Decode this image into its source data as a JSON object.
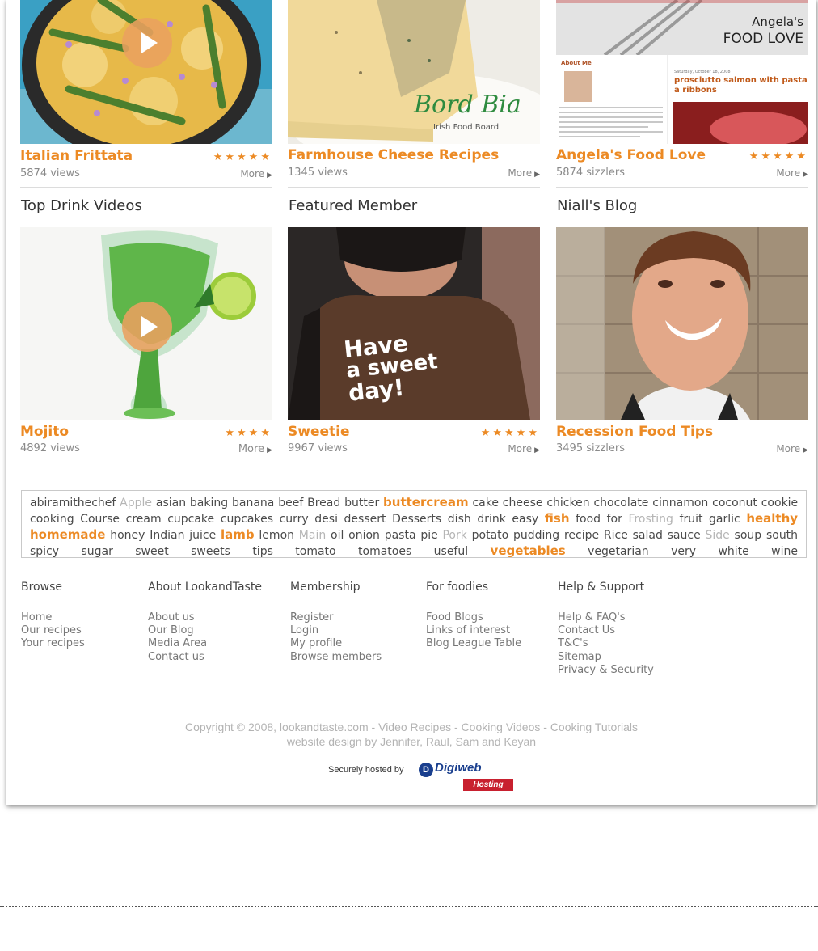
{
  "top_cards": [
    {
      "title": "Italian Frittata",
      "sub": "5874 views",
      "more": "More",
      "stars": "★★★★★"
    },
    {
      "title": "Farmhouse Cheese Recipes",
      "sub": "1345 views",
      "more": "More",
      "stars": ""
    },
    {
      "title": "Angela's Food Love",
      "sub": "5874 sizzlers",
      "more": "More",
      "stars": "★★★★★"
    }
  ],
  "top_images": {
    "cheese_brand": "Bord Bia",
    "cheese_brand_sub": "Irish Food Board",
    "angela_blog_title_1": "Angela's",
    "angela_blog_title_2": "FOOD LOVE",
    "angela_about": "About Me",
    "angela_post_date": "Saturday, October 18, 2008",
    "angela_post_title": "prosciutto salmon with pasta a ribbons"
  },
  "sections": {
    "drinks": "Top Drink Videos",
    "member": "Featured Member",
    "blog": "Niall's Blog"
  },
  "bottom_cards": [
    {
      "title": "Mojito",
      "sub": "4892 views",
      "more": "More",
      "stars": "★★★★"
    },
    {
      "title": "Sweetie",
      "sub": "9967 views",
      "more": "More",
      "stars": "★★★★★"
    },
    {
      "title": "Recession Food Tips",
      "sub": "3495 sizzlers",
      "more": "More",
      "stars": ""
    }
  ],
  "apron_text": {
    "line1": "Have",
    "line2": "a sweet",
    "line3": "day!"
  },
  "tags": [
    {
      "t": "abiramithechef",
      "s": "n"
    },
    {
      "t": "Apple",
      "s": "l"
    },
    {
      "t": "asian",
      "s": "n"
    },
    {
      "t": "baking",
      "s": "n"
    },
    {
      "t": "banana",
      "s": "n"
    },
    {
      "t": "beef",
      "s": "n"
    },
    {
      "t": "Bread",
      "s": "n"
    },
    {
      "t": "butter",
      "s": "n"
    },
    {
      "t": "buttercream",
      "s": "h"
    },
    {
      "t": "cake",
      "s": "n"
    },
    {
      "t": "cheese",
      "s": "n"
    },
    {
      "t": "chicken",
      "s": "n"
    },
    {
      "t": "chocolate",
      "s": "n"
    },
    {
      "t": "cinnamon",
      "s": "n"
    },
    {
      "t": "coconut",
      "s": "n"
    },
    {
      "t": "cookie",
      "s": "n"
    },
    {
      "t": "cooking",
      "s": "n"
    },
    {
      "t": "Course",
      "s": "n"
    },
    {
      "t": "cream",
      "s": "n"
    },
    {
      "t": "cupcake",
      "s": "n"
    },
    {
      "t": "cupcakes",
      "s": "n"
    },
    {
      "t": "curry",
      "s": "n"
    },
    {
      "t": "desi",
      "s": "n"
    },
    {
      "t": "dessert",
      "s": "n"
    },
    {
      "t": "Desserts",
      "s": "n"
    },
    {
      "t": "dish",
      "s": "n"
    },
    {
      "t": "drink",
      "s": "n"
    },
    {
      "t": "easy",
      "s": "n"
    },
    {
      "t": "fish",
      "s": "h"
    },
    {
      "t": "food",
      "s": "n"
    },
    {
      "t": "for",
      "s": "n"
    },
    {
      "t": "Frosting",
      "s": "l"
    },
    {
      "t": "fruit",
      "s": "n"
    },
    {
      "t": "garlic",
      "s": "n"
    },
    {
      "t": "healthy",
      "s": "h"
    },
    {
      "t": "homemade",
      "s": "h"
    },
    {
      "t": "honey",
      "s": "n"
    },
    {
      "t": "Indian",
      "s": "n"
    },
    {
      "t": "juice",
      "s": "n"
    },
    {
      "t": "lamb",
      "s": "h"
    },
    {
      "t": "lemon",
      "s": "n"
    },
    {
      "t": "Main",
      "s": "l"
    },
    {
      "t": "oil",
      "s": "n"
    },
    {
      "t": "onion",
      "s": "n"
    },
    {
      "t": "pasta",
      "s": "n"
    },
    {
      "t": "pie",
      "s": "n"
    },
    {
      "t": "Pork",
      "s": "l"
    },
    {
      "t": "potato",
      "s": "n"
    },
    {
      "t": "pudding",
      "s": "n"
    },
    {
      "t": "recipe",
      "s": "n"
    },
    {
      "t": "Rice",
      "s": "n"
    },
    {
      "t": "salad",
      "s": "n"
    },
    {
      "t": "sauce",
      "s": "n"
    },
    {
      "t": "Side",
      "s": "l"
    },
    {
      "t": "soup",
      "s": "n"
    },
    {
      "t": "south",
      "s": "n"
    },
    {
      "t": "spicy",
      "s": "n"
    },
    {
      "t": "sugar",
      "s": "n"
    },
    {
      "t": "sweet",
      "s": "n"
    },
    {
      "t": "sweets",
      "s": "n"
    },
    {
      "t": "tips",
      "s": "n"
    },
    {
      "t": "tomato",
      "s": "n"
    },
    {
      "t": "tomatoes",
      "s": "n"
    },
    {
      "t": "useful",
      "s": "n"
    },
    {
      "t": "vegetables",
      "s": "h"
    },
    {
      "t": "vegetarian",
      "s": "n"
    },
    {
      "t": "very",
      "s": "n"
    },
    {
      "t": "white",
      "s": "n"
    },
    {
      "t": "wine",
      "s": "n"
    }
  ],
  "footer": {
    "columns": [
      {
        "heading": "Browse",
        "links": [
          "Home",
          "Our recipes",
          "Your recipes"
        ]
      },
      {
        "heading": "About LookandTaste",
        "links": [
          "About us",
          "Our Blog",
          "Media Area",
          "Contact us"
        ]
      },
      {
        "heading": "Membership",
        "links": [
          "Register",
          "Login",
          "My profile",
          "Browse members"
        ]
      },
      {
        "heading": "For foodies",
        "links": [
          "Food Blogs",
          "Links of interest",
          "Blog League Table"
        ]
      },
      {
        "heading": "Help & Support",
        "links": [
          "Help & FAQ's",
          "Contact Us",
          "T&C's",
          "Sitemap",
          "Privacy & Security"
        ]
      }
    ],
    "copyright_line1": "Copyright © 2008, lookandtaste.com - Video Recipes - Cooking Videos - Cooking Tutorials",
    "copyright_line2": "website design by Jennifer, Raul, Sam and Keyan",
    "hosted_by": "Securely hosted by",
    "host_name": "Digiweb",
    "host_badge": "Hosting",
    "host_initial": "D"
  },
  "colors": {
    "accent": "#ec8a24",
    "muted": "#8a8a8a",
    "host_blue": "#1a3f8e",
    "host_red": "#c8202f"
  }
}
